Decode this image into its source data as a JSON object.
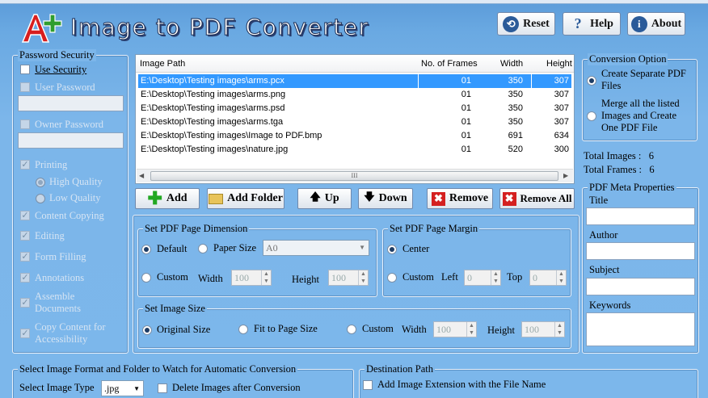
{
  "app": {
    "title": "Image to PDF Converter"
  },
  "top_buttons": {
    "reset": "Reset",
    "help": "Help",
    "about": "About"
  },
  "password": {
    "legend": "Password Security",
    "use_security": "Use Security",
    "user_password": "User Password",
    "owner_password": "Owner Password",
    "printing": "Printing",
    "high_quality": "High Quality",
    "low_quality": "Low Quality",
    "content_copying": "Content Copying",
    "editing": "Editing",
    "form_filling": "Form Filling",
    "annotations": "Annotations",
    "assemble_1": "Assemble",
    "assemble_2": "Documents",
    "copy_access_1": "Copy Content for",
    "copy_access_2": "Accessibility"
  },
  "grid": {
    "headers": [
      "Image Path",
      "No. of Frames",
      "Width",
      "Height"
    ],
    "rows": [
      {
        "path": "E:\\Desktop\\Testing images\\arms.pcx",
        "frames": "01",
        "width": "350",
        "height": "307"
      },
      {
        "path": "E:\\Desktop\\Testing images\\arms.png",
        "frames": "01",
        "width": "350",
        "height": "307"
      },
      {
        "path": "E:\\Desktop\\Testing images\\arms.psd",
        "frames": "01",
        "width": "350",
        "height": "307"
      },
      {
        "path": "E:\\Desktop\\Testing images\\arms.tga",
        "frames": "01",
        "width": "350",
        "height": "307"
      },
      {
        "path": "E:\\Desktop\\Testing images\\Image to PDF.bmp",
        "frames": "01",
        "width": "691",
        "height": "634"
      },
      {
        "path": "E:\\Desktop\\Testing images\\nature.jpg",
        "frames": "01",
        "width": "520",
        "height": "300"
      }
    ],
    "scroll_grip": "III"
  },
  "actions": {
    "add": "Add",
    "add_folder": "Add Folder",
    "up": "Up",
    "down": "Down",
    "remove": "Remove",
    "remove_all": "Remove All"
  },
  "dimension": {
    "legend": "Set PDF Page Dimension",
    "default": "Default",
    "paper_size": "Paper Size",
    "paper_value": "A0",
    "custom": "Custom",
    "width": "Width",
    "width_value": "100",
    "height": "Height",
    "height_value": "100"
  },
  "margin": {
    "legend": "Set PDF Page Margin",
    "center": "Center",
    "custom": "Custom",
    "left": "Left",
    "left_value": "0",
    "top": "Top",
    "top_value": "0"
  },
  "image_size": {
    "legend": "Set Image Size",
    "original": "Original Size",
    "fit": "Fit to Page Size",
    "custom": "Custom",
    "width": "Width",
    "width_value": "100",
    "height": "Height",
    "height_value": "100"
  },
  "conversion": {
    "legend": "Conversion Option",
    "opt1_1": "Create Separate PDF",
    "opt1_2": "Files",
    "opt2_1": "Merge all the listed",
    "opt2_2": "Images and Create",
    "opt2_3": "One PDF File"
  },
  "totals": {
    "images_label": "Total Images :",
    "images_value": "6",
    "frames_label": "Total Frames :",
    "frames_value": "6"
  },
  "meta": {
    "legend": "PDF Meta Properties",
    "title": "Title",
    "author": "Author",
    "subject": "Subject",
    "keywords": "Keywords"
  },
  "watch": {
    "legend": "Select Image Format and Folder to Watch for Automatic Conversion",
    "format_label": "Select Image Type",
    "format_value": ".jpg",
    "delete_label": "Delete Images after Conversion"
  },
  "destination": {
    "legend": "Destination Path",
    "add_ext": "Add Image Extension with the File Name"
  },
  "colors": {
    "background": "#7cb6ea",
    "selection": "#3399ff"
  }
}
